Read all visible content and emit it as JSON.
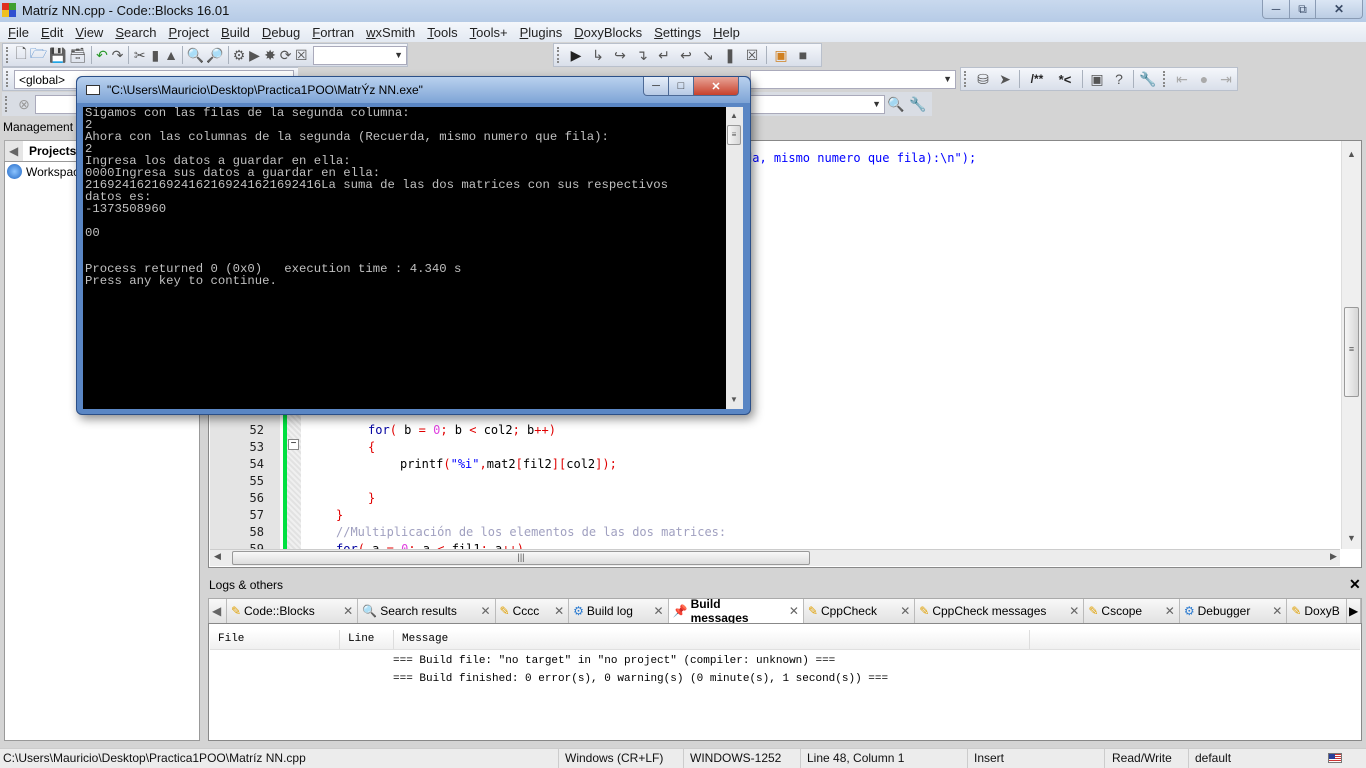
{
  "window": {
    "title": "Matríz NN.cpp - Code::Blocks 16.01",
    "controls": [
      "minimize",
      "restore",
      "close"
    ]
  },
  "menubar": [
    "File",
    "Edit",
    "View",
    "Search",
    "Project",
    "Build",
    "Debug",
    "Fortran",
    "wxSmith",
    "Tools",
    "Tools+",
    "Plugins",
    "DoxyBlocks",
    "Settings",
    "Help"
  ],
  "toolbar": {
    "main_icons": [
      "new-file-icon",
      "open-file-icon",
      "save-icon",
      "save-all-icon",
      "undo-icon",
      "redo-icon",
      "cut-icon",
      "copy-icon",
      "paste-icon",
      "find-icon",
      "replace-icon"
    ],
    "build_icons": [
      "build-icon",
      "run-icon",
      "build-run-icon",
      "rebuild-icon",
      "abort-icon"
    ],
    "build_target_value": "",
    "debug_icons": [
      "debug-continue-icon",
      "run-to-cursor-icon",
      "next-line-icon",
      "step-into-icon",
      "step-out-icon",
      "next-instruction-icon",
      "step-into-instruction-icon",
      "break-icon",
      "stop-debug-icon",
      "debug-windows-icon",
      "various-info-icon"
    ],
    "scope_combo": "<global>",
    "function_combo": "",
    "doxy_labels": [
      "/**",
      "*<"
    ],
    "search_value": ""
  },
  "left_panel": {
    "title": "Management",
    "tab": "Projects",
    "tree_item": "Workspace"
  },
  "editor": {
    "visible_partial_line": "da, mismo numero que fila):\\n\");",
    "lines": [
      {
        "n": "52",
        "code": "for( b = 0; b < col2; b++)"
      },
      {
        "n": "53",
        "code": "{"
      },
      {
        "n": "54",
        "code": "printf(\"%i\",mat2[fil2][col2]);"
      },
      {
        "n": "55",
        "code": ""
      },
      {
        "n": "56",
        "code": "}"
      },
      {
        "n": "57",
        "code": "}"
      },
      {
        "n": "58",
        "code": "//Multiplicación de los elementos de las dos matrices:"
      },
      {
        "n": "59",
        "code": "for( a = 0; a < fil1; a++)"
      }
    ]
  },
  "console": {
    "title": "\"C:\\Users\\Mauricio\\Desktop\\Practica1POO\\MatrÝz NN.exe\"",
    "output": "Sigamos con las filas de la segunda columna:\n2\nAhora con las columnas de la segunda (Recuerda, mismo numero que fila):\n2\nIngresa los datos a guardar en ella:\n0000Ingresa sus datos a guardar en ella:\n21692416216924162169241621692416La suma de las dos matrices con sus respectivos\ndatos es:\n-1373508960\n\n00\n\n\nProcess returned 0 (0x0)   execution time : 4.340 s\nPress any key to continue."
  },
  "logs": {
    "title": "Logs & others",
    "tabs": [
      {
        "label": "Code::Blocks",
        "icon": "pencil-icon"
      },
      {
        "label": "Search results",
        "icon": "magnifier-icon"
      },
      {
        "label": "Cccc",
        "icon": "pencil-icon"
      },
      {
        "label": "Build log",
        "icon": "gear-icon"
      },
      {
        "label": "Build messages",
        "icon": "pin-icon",
        "active": true
      },
      {
        "label": "CppCheck",
        "icon": "pencil-icon"
      },
      {
        "label": "CppCheck messages",
        "icon": "pencil-icon"
      },
      {
        "label": "Cscope",
        "icon": "pencil-icon"
      },
      {
        "label": "Debugger",
        "icon": "gear-icon"
      },
      {
        "label": "DoxyB",
        "icon": "pencil-icon"
      }
    ],
    "columns": [
      "File",
      "Line",
      "Message"
    ],
    "messages": [
      "=== Build file: \"no target\" in \"no project\" (compiler: unknown) ===",
      "=== Build finished: 0 error(s), 0 warning(s) (0 minute(s), 1 second(s)) ==="
    ]
  },
  "statusbar": {
    "path": "C:\\Users\\Mauricio\\Desktop\\Practica1POO\\Matríz NN.cpp",
    "eol": "Windows (CR+LF)",
    "encoding": "WINDOWS-1252",
    "position": "Line 48, Column 1",
    "mode": "Insert",
    "access": "Read/Write",
    "profile": "default"
  },
  "colors": {
    "changebar": "#00e040",
    "keyword": "#0000a0",
    "number": "#e040e0",
    "operator": "#e00000",
    "string": "#0000ff",
    "comment": "#a0a0c0"
  }
}
